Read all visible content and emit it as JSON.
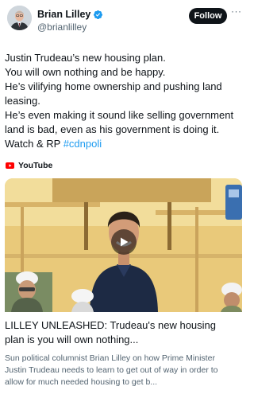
{
  "author": {
    "name": "Brian Lilley",
    "handle": "@brianlilley",
    "verified": true
  },
  "actions": {
    "follow_label": "Follow",
    "more_label": "···"
  },
  "tweet": {
    "lines": [
      "Justin Trudeau’s new housing plan.",
      "You will own nothing and be happy.",
      "He’s vilifying home ownership and pushing land",
      "leasing.",
      "He’s even making it sound like selling government",
      "land is bad, even as his government is doing it."
    ],
    "last_line_text": "Watch & RP ",
    "hashtag": "#cdnpoli"
  },
  "link_card": {
    "source": "YouTube",
    "title_lines": [
      "LILLEY UNLEASHED: Trudeau's new housing",
      "plan is you will own nothing..."
    ],
    "description_lines": [
      "Sun political columnist Brian Lilley on how Prime Minister",
      "Justin Trudeau needs to learn to get out of way in order to",
      "allow for much needed housing to get b..."
    ]
  },
  "colors": {
    "text": "#0f1419",
    "secondary": "#536471",
    "link": "#1d9bf0",
    "verified": "#1d9bf0",
    "youtube": "#ff0000"
  }
}
